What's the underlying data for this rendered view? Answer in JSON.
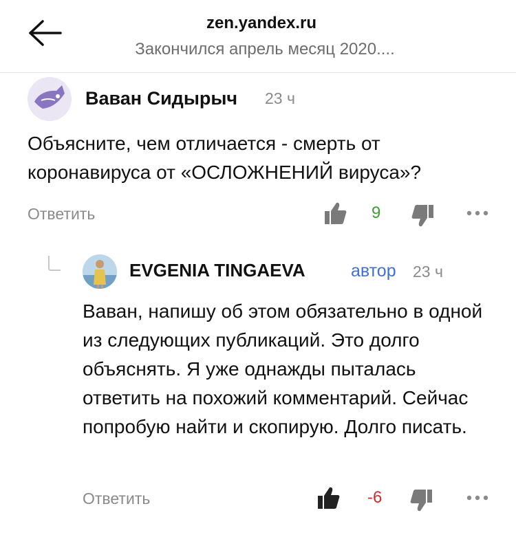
{
  "header": {
    "domain": "zen.yandex.ru",
    "title": "Закончился апрель месяц 2020...."
  },
  "comments": [
    {
      "author": "Ваван Сидырыч",
      "time": "23 ч",
      "text": "Объясните, чем отличается - смерть от коронавируса от «ОСЛОЖНЕНИЙ вируса»?",
      "reply_label": "Ответить",
      "score": "9"
    },
    {
      "author": "EVGENIA TINGAEVA",
      "badge": "автор",
      "time": "23 ч",
      "text": "Ваван, напишу об этом обязательно в одной из следующих публикаций. Это долго объяснять. Я уже однажды пыталась ответить на похожий комментарий. Сейчас попробую найти и скопирую. Долго писать.",
      "reply_label": "Ответить",
      "score": "-6"
    }
  ],
  "colors": {
    "positive_score": "#3aa02f",
    "negative_score": "#d72b2b",
    "author_badge": "#3f6fd8"
  }
}
